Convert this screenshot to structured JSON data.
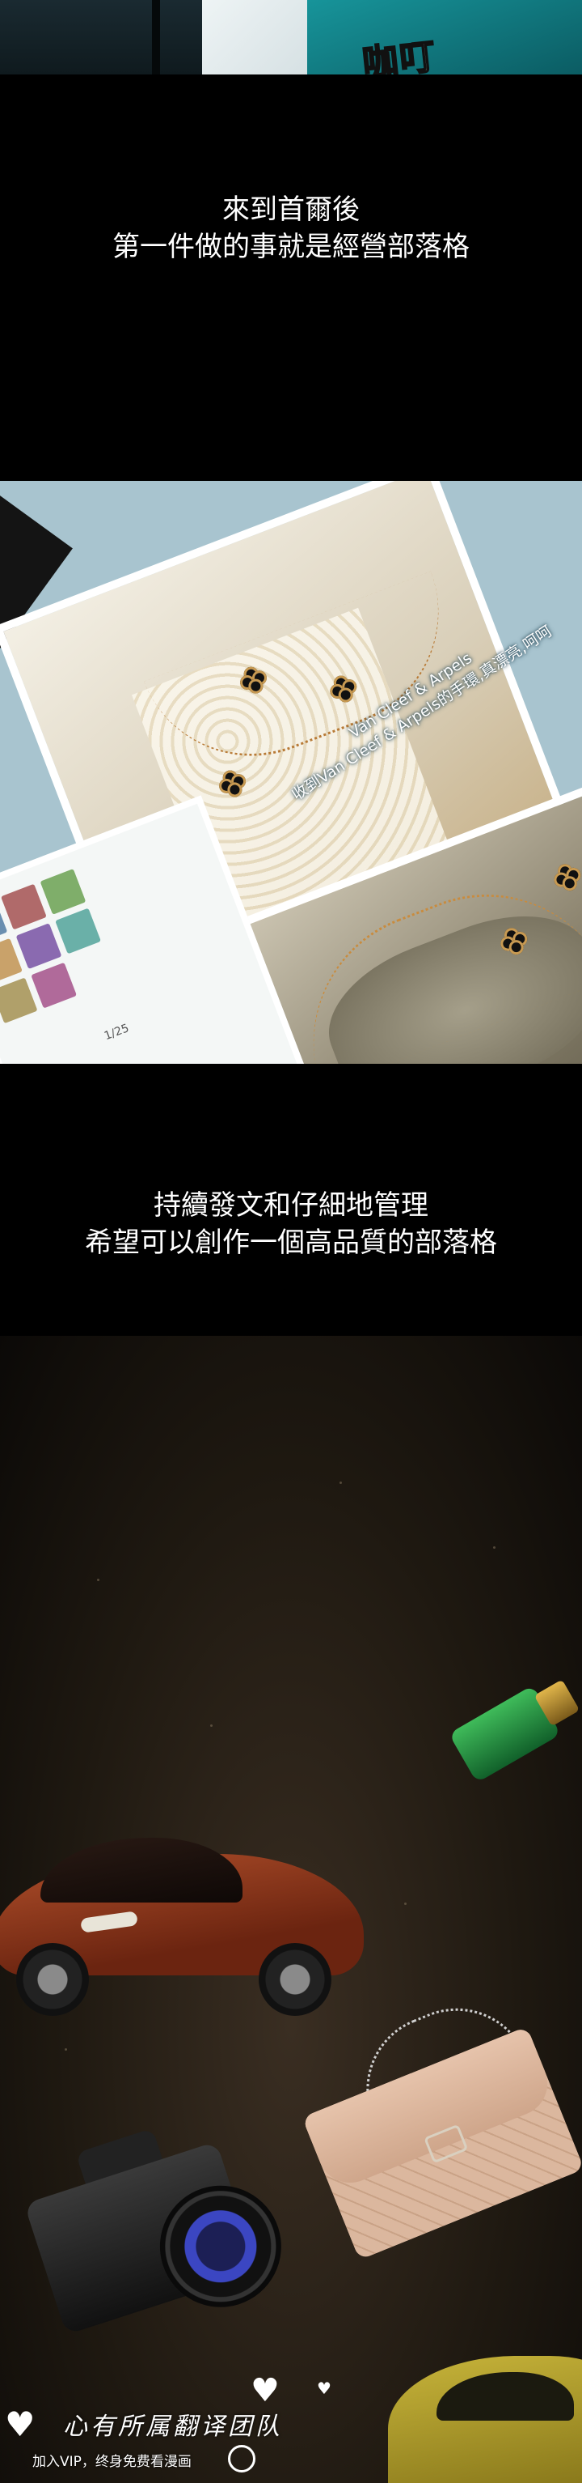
{
  "top_panel": {
    "sound_effect": "咖叮"
  },
  "narration_1": {
    "line1": "來到首爾後",
    "line2": "第一件做的事就是經營部落格"
  },
  "blog_panel": {
    "caption_line1": "Van Cleef & Arpels",
    "caption_line2": "收到Van Cleef & Arpels的手環,真漂亮,呵呵",
    "page_indicator": "1/25"
  },
  "narration_2": {
    "line1": "持續發文和仔細地管理",
    "line2": "希望可以創作一個高品質的部落格"
  },
  "watermark": {
    "title": "心有所属翻译团队",
    "subtitle": "加入VIP，终身免费看漫画"
  },
  "colors": {
    "background": "#000000",
    "sky_blue": "#a8c4cf",
    "car_red": "#b2502b",
    "bottle_green": "#3fbb5a",
    "bag_beige": "#dbb79e",
    "lens_blue": "#3b46c2"
  }
}
